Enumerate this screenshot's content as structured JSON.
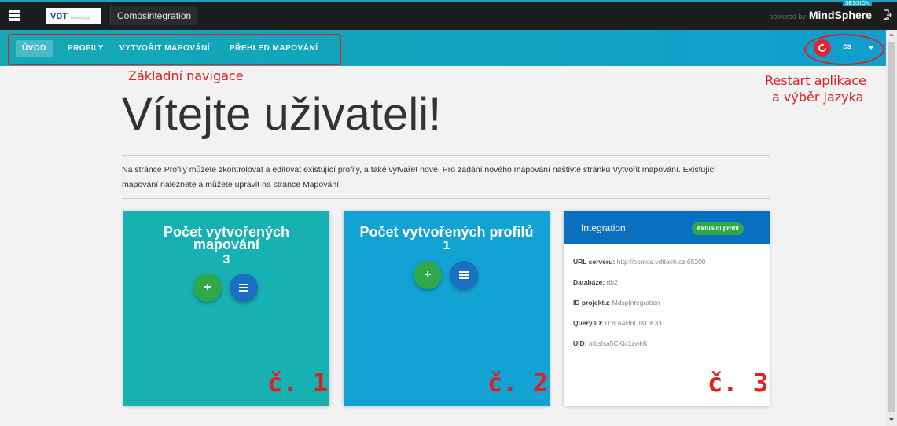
{
  "topbar": {
    "logo_text": "VDT",
    "logo_sub": "technology",
    "app_title": "Comosintegration",
    "powered_by": "powered by",
    "brand": "MindSphere",
    "beta_badge": "SESSION",
    "icons": [
      "apps-grid-icon",
      "logout-icon"
    ]
  },
  "nav": {
    "items": [
      {
        "label": "ÚVOD",
        "active": true
      },
      {
        "label": "PROFILY",
        "active": false
      },
      {
        "label": "VYTVOŘIT MAPOVÁNÍ",
        "active": false
      },
      {
        "label": "PŘEHLED MAPOVÁNÍ",
        "active": false
      }
    ],
    "language": "cs",
    "restart_icon": "restart-icon"
  },
  "annotations": {
    "nav_label": "Základní navigace",
    "restart_label_line1": "Restart aplikace",
    "restart_label_line2": "a výběr jazyka",
    "card1_label": "č. 1",
    "card2_label": "č. 2",
    "card3_label": "č. 3",
    "color": "#e02020"
  },
  "main": {
    "welcome": "Vítejte uživateli!",
    "intro_line1": "Na stránce Profily můžete zkontrolovat a editovat existující profily, a také vytvářet nové. Pro zadání nového mapování naštivte stránku Vytvořit mapování. Existující",
    "intro_line2": "mapování naleznete a můžete upravit na stránce Mapování."
  },
  "cards": {
    "mappings": {
      "title_line1": "Počet vytvořených",
      "title_line2": "mapování",
      "count": "3",
      "add": "+",
      "list_icon": "list-icon"
    },
    "profiles": {
      "title": "Počet vytvořených profilů",
      "count": "1",
      "add": "+",
      "list_icon": "list-icon"
    },
    "profile": {
      "title": "Integration",
      "badge": "Aktuální profil",
      "rows": [
        {
          "key": "URL serveru:",
          "value": "http://comos.vdttech.cz:65200"
        },
        {
          "key": "Databáze:",
          "value": "db2"
        },
        {
          "key": "ID projektu:",
          "value": "MdspIntegration"
        },
        {
          "key": "Query ID:",
          "value": "U:8:A4H6DIKCK3:U"
        },
        {
          "key": "UID:",
          "value": "mbslsa5CKic1zwkK"
        }
      ]
    }
  },
  "colors": {
    "topbar": "#1d1d1d",
    "nav_teal": "#14a9b5",
    "card_mappings": "#17b0b3",
    "card_profiles": "#13a2d4",
    "card_profile_header": "#0b6fc0",
    "add_button": "#2ea84a",
    "list_button": "#1a6fc4",
    "restart_button": "#e02431"
  }
}
